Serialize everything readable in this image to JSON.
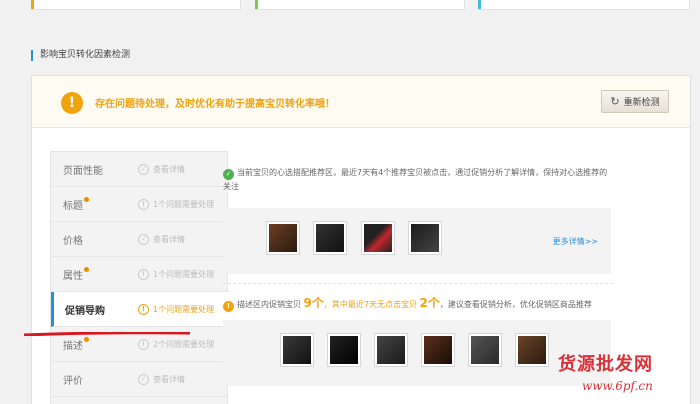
{
  "section_title": "影响宝贝转化因素检测",
  "alert": {
    "icon": "warning-icon",
    "text": "存在问题待处理，及时优化有助于提高宝贝转化率哦！",
    "button_label": "重新检测"
  },
  "sidebar": {
    "items": [
      {
        "label": "页面性能",
        "status": "查看详情",
        "has_dot": false,
        "type": "ok"
      },
      {
        "label": "标题",
        "status": "1个问题需要处理",
        "has_dot": true,
        "type": "issue"
      },
      {
        "label": "价格",
        "status": "查看详情",
        "has_dot": false,
        "type": "ok"
      },
      {
        "label": "属性",
        "status": "1个问题需要处理",
        "has_dot": true,
        "type": "issue"
      },
      {
        "label": "促销导购",
        "status": "1个问题需要处理",
        "has_dot": false,
        "type": "issue",
        "active": true
      },
      {
        "label": "描述",
        "status": "2个问题需要处理",
        "has_dot": true,
        "type": "issue"
      },
      {
        "label": "评价",
        "status": "查看详情",
        "has_dot": false,
        "type": "ok"
      }
    ]
  },
  "details": {
    "row1": {
      "text": "当前宝贝的心选搭配推荐区，最近7天有4个推荐宝贝被点击，通过促销分析了解详情，保持对心选推荐的关注",
      "more_link": "更多详情>>"
    },
    "row2": {
      "text_a": "描述区内促销宝贝",
      "count_a": "9个",
      "text_b": "，其中最近7天无点击宝贝",
      "count_b": "2个",
      "text_c": "，建议查看促销分析，优化促销区商品推荐"
    }
  },
  "watermark": {
    "line1": "货源批发网",
    "line2": "www.6pf.cn"
  },
  "colors": {
    "accent": "#2b8fd6",
    "warning": "#f0a30a",
    "success": "#4caf50",
    "mark_line": "#d8171f"
  }
}
